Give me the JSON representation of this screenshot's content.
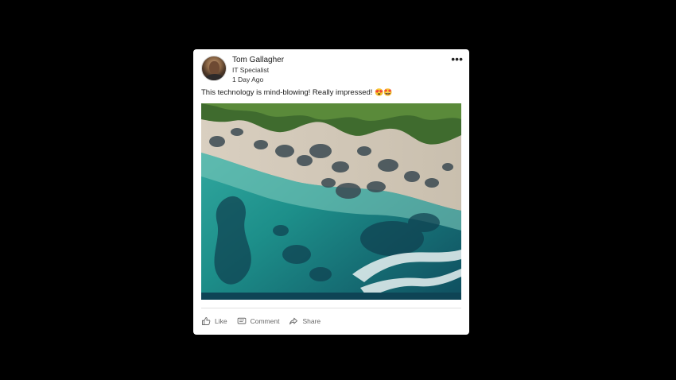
{
  "post": {
    "author_name": "Tom Gallagher",
    "author_title": "IT Specialist",
    "timestamp": "1 Day Ago",
    "more_icon": "more-horizontal-icon",
    "text": "This technology is mind-blowing! Really impressed!",
    "emojis": "😍🤩",
    "image_icon": "aerial-beach-photo"
  },
  "actions": {
    "like_label": "Like",
    "comment_label": "Comment",
    "share_label": "Share"
  },
  "colors": {
    "page_background": "#000000",
    "card_background": "#ffffff",
    "action_text": "#666666"
  }
}
